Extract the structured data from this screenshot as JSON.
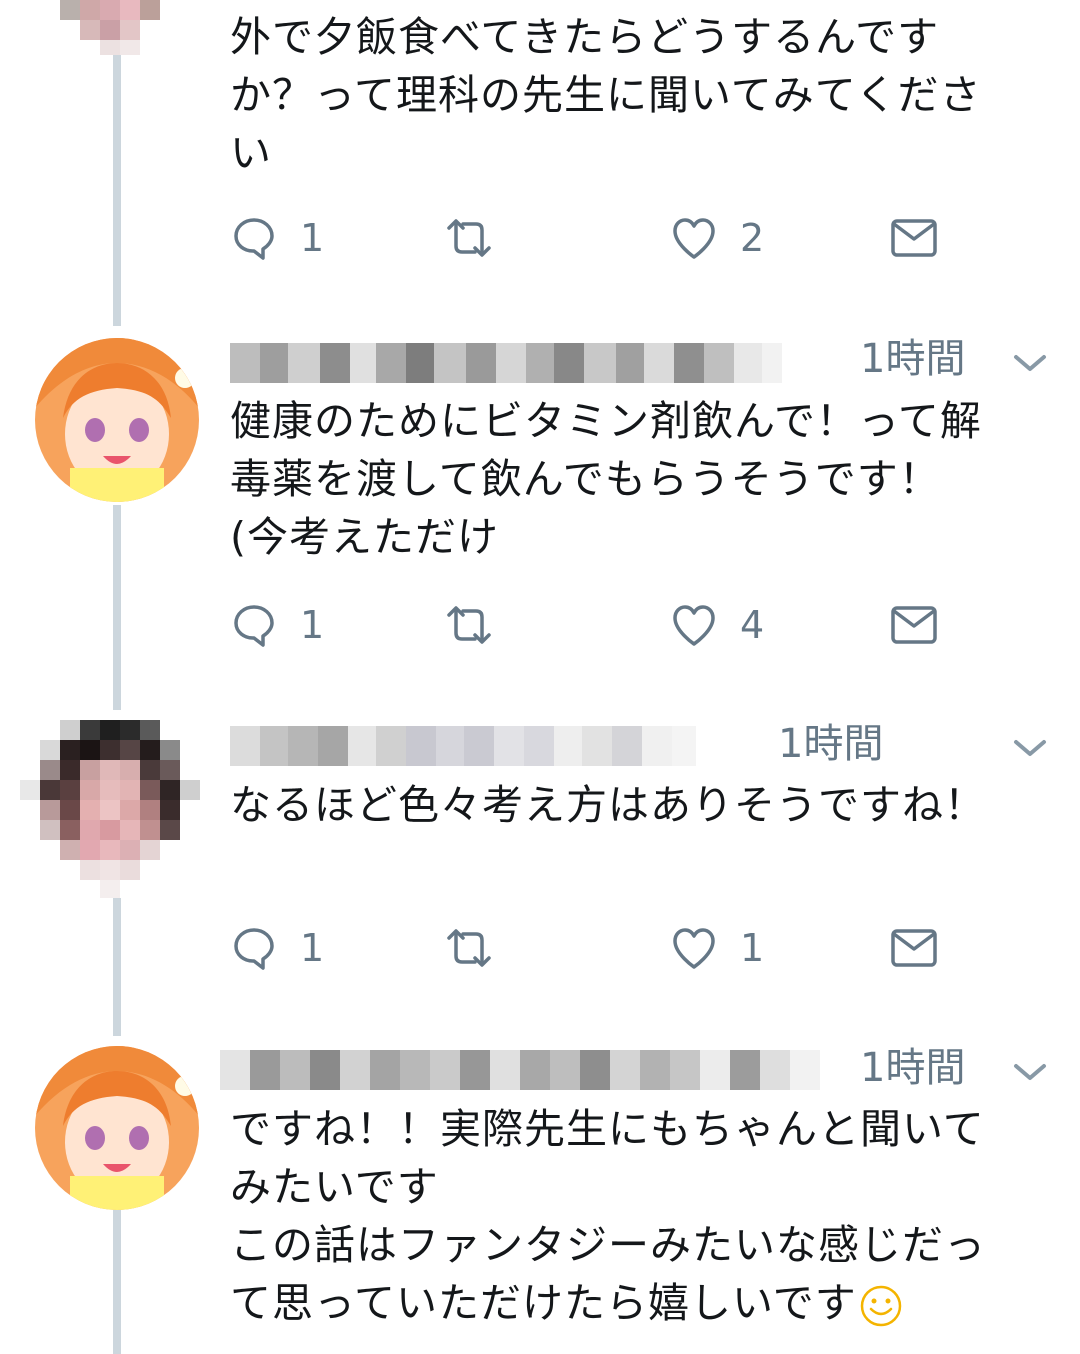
{
  "colors": {
    "text": "#14171a",
    "muted": "#657786",
    "thread_line": "#ccd6dd",
    "emoji": "#f4b400"
  },
  "icons": {
    "reply": "speech-bubble",
    "retweet": "two-arrows-loop",
    "like": "heart",
    "dm": "envelope",
    "menu": "chevron-down",
    "emoji": "smiling-face"
  },
  "tweets": [
    {
      "text": "外で夕飯食べてきたらどうするんです\nか？って理科の先生に聞いてみてくださ\nい",
      "reply_count": "1",
      "retweet_count": "",
      "like_count": "2"
    },
    {
      "time": "1時間",
      "text": "健康のためにビタミン剤飲んで！って解\n毒薬を渡して飲んでもらうそうです！\n(今考えただけ",
      "reply_count": "1",
      "retweet_count": "",
      "like_count": "4"
    },
    {
      "time": "1時間",
      "text": "なるほど色々考え方はありそうですね！",
      "reply_count": "1",
      "retweet_count": "",
      "like_count": "1"
    },
    {
      "time": "1時間",
      "text": "ですね！！実際先生にもちゃんと聞いて\nみたいです\nこの話はファンタジーみたいな感じだっ\nて思っていただけたら嬉しいです",
      "reply_count": "",
      "retweet_count": "",
      "like_count": ""
    }
  ]
}
